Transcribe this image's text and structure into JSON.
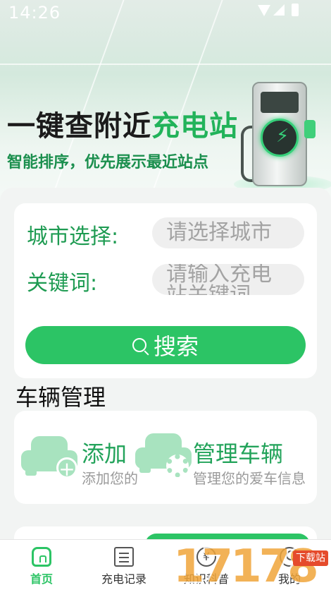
{
  "status": {
    "time": "14:26"
  },
  "hero": {
    "title_main": "一键查附近",
    "title_accent": "充电站",
    "subtitle": "智能排序，优先展示最近站点"
  },
  "search": {
    "city_label": "城市选择:",
    "city_placeholder": "请选择城市",
    "keyword_label": "关键词:",
    "keyword_placeholder": "请输入充电站关键词",
    "button_label": "搜索"
  },
  "vehicle": {
    "section_title": "车辆管理",
    "add_title": "添加",
    "add_subtitle": "添加您的",
    "manage_title": "管理车辆",
    "manage_subtitle": "管理您的爱车信息"
  },
  "nav": {
    "items": [
      {
        "label": "首页",
        "icon": "home-icon",
        "active": true
      },
      {
        "label": "充电记录",
        "icon": "record-icon",
        "active": false
      },
      {
        "label": "知识科普",
        "icon": "yen-icon",
        "active": false
      },
      {
        "label": "我的",
        "icon": "user-icon",
        "active": false
      }
    ]
  },
  "watermark": {
    "text": "17178",
    "tag": "下载站"
  },
  "colors": {
    "accent": "#2cc465",
    "accent_dark": "#1e9b52",
    "light_green": "#a8e3bf"
  }
}
